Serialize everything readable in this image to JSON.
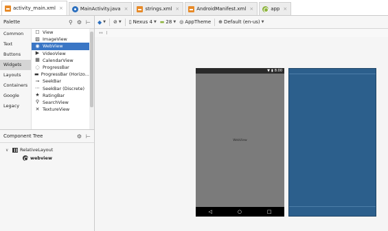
{
  "tabs": [
    {
      "label": "activity_main.xml",
      "icon": "xml-file-icon",
      "active": true
    },
    {
      "label": "MainActivity.java",
      "icon": "java-class-icon",
      "active": false
    },
    {
      "label": "strings.xml",
      "icon": "xml-file-icon",
      "active": false
    },
    {
      "label": "AndroidManifest.xml",
      "icon": "xml-file-icon",
      "active": false
    },
    {
      "label": "app",
      "icon": "android-module-icon",
      "active": false
    }
  ],
  "palette": {
    "title": "Palette",
    "categories": [
      "Common",
      "Text",
      "Buttons",
      "Widgets",
      "Layouts",
      "Containers",
      "Google",
      "Legacy"
    ],
    "selected_category": "Widgets",
    "items": [
      {
        "label": "View",
        "icon": "view-icon"
      },
      {
        "label": "ImageView",
        "icon": "image-icon"
      },
      {
        "label": "WebView",
        "icon": "globe-icon"
      },
      {
        "label": "VideoView",
        "icon": "video-icon"
      },
      {
        "label": "CalendarView",
        "icon": "calendar-icon"
      },
      {
        "label": "ProgressBar",
        "icon": "progress-circle-icon"
      },
      {
        "label": "ProgressBar (Horizo...",
        "icon": "progress-horizontal-icon"
      },
      {
        "label": "SeekBar",
        "icon": "seekbar-icon"
      },
      {
        "label": "SeekBar (Discrete)",
        "icon": "seekbar-discrete-icon"
      },
      {
        "label": "RatingBar",
        "icon": "star-icon"
      },
      {
        "label": "SearchView",
        "icon": "search-icon"
      },
      {
        "label": "TextureView",
        "icon": "texture-icon"
      }
    ],
    "selected_item": "WebView"
  },
  "component_tree": {
    "title": "Component Tree",
    "root": "RelativeLayout",
    "child": "webview"
  },
  "toolbar": {
    "device": "Nexus 4",
    "api": "28",
    "theme": "AppTheme",
    "locale": "Default (en-us)"
  },
  "phone": {
    "status_time": "8:00",
    "content_label": "WebView"
  },
  "colors": {
    "selection": "#3a76c5",
    "phone_screen": "#7b7b7b",
    "blueprint": "#2c5f8c"
  }
}
